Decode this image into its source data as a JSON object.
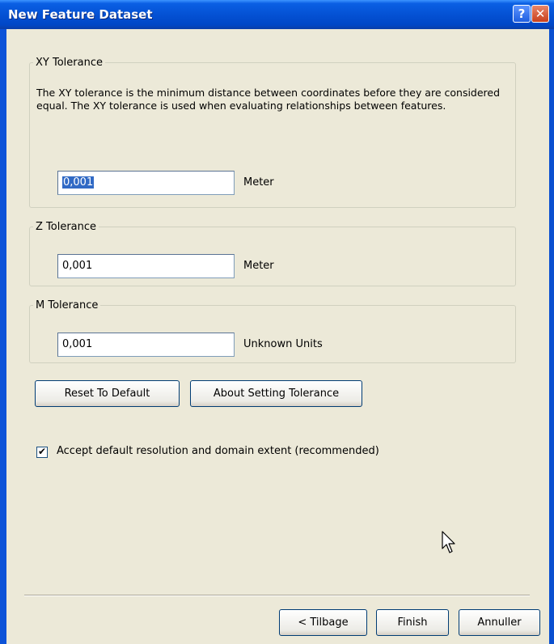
{
  "window": {
    "title": "New Feature Dataset",
    "help_icon": "?",
    "close_icon": "✕"
  },
  "xy": {
    "legend": "XY Tolerance",
    "description": "The XY tolerance is the minimum distance between coordinates before they are considered equal. The XY tolerance is used when evaluating relationships between features.",
    "value": "0,001",
    "unit": "Meter"
  },
  "z": {
    "legend": "Z Tolerance",
    "value": "0,001",
    "unit": "Meter"
  },
  "m": {
    "legend": "M Tolerance",
    "value": "0,001",
    "unit": "Unknown Units"
  },
  "buttons": {
    "reset": "Reset To Default",
    "about": "About Setting Tolerance",
    "back": "< Tilbage",
    "finish": "Finish",
    "cancel": "Annuller"
  },
  "accept": {
    "checked": true,
    "check_mark": "✔",
    "label": "Accept default resolution and domain extent (recommended)"
  }
}
